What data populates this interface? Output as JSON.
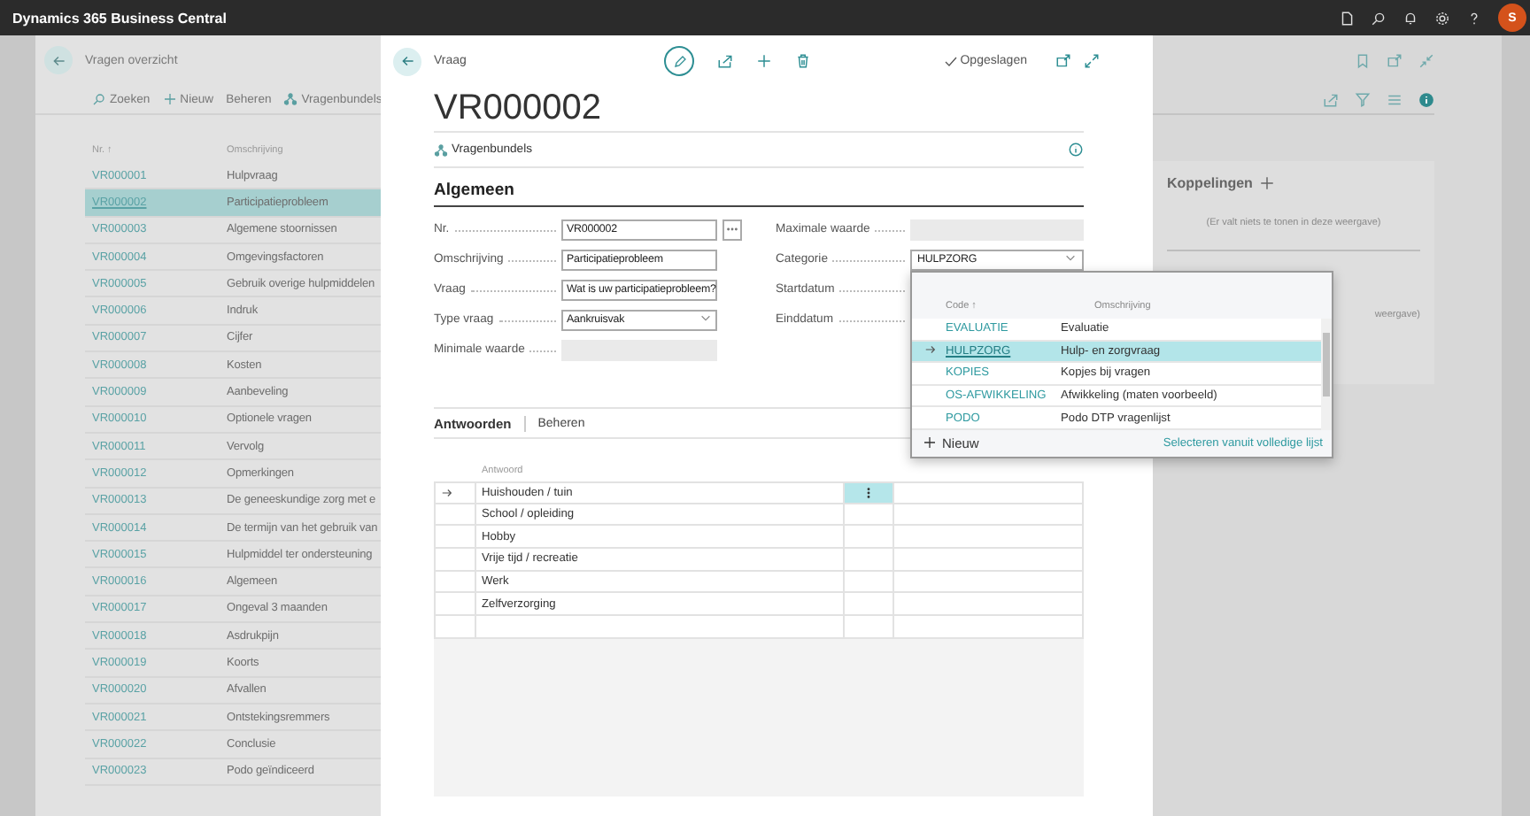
{
  "app_bar": {
    "title": "Dynamics 365 Business Central",
    "avatar": "S"
  },
  "background_page": {
    "title": "Vragen overzicht",
    "actions": [
      "Zoeken",
      "Nieuw",
      "Beheren",
      "Vragenbundels"
    ],
    "columns": [
      "Nr. ↑",
      "Omschrijving"
    ],
    "rows": [
      {
        "nr": "VR000001",
        "description": "Hulpvraag",
        "selected": false
      },
      {
        "nr": "VR000002",
        "description": "Participatieprobleem",
        "selected": true
      },
      {
        "nr": "VR000003",
        "description": "Algemene stoornissen",
        "selected": false
      },
      {
        "nr": "VR000004",
        "description": "Omgevingsfactoren",
        "selected": false
      },
      {
        "nr": "VR000005",
        "description": "Gebruik overige hulpmiddelen",
        "selected": false
      },
      {
        "nr": "VR000006",
        "description": "Indruk",
        "selected": false
      },
      {
        "nr": "VR000007",
        "description": "Cijfer",
        "selected": false
      },
      {
        "nr": "VR000008",
        "description": "Kosten",
        "selected": false
      },
      {
        "nr": "VR000009",
        "description": "Aanbeveling",
        "selected": false
      },
      {
        "nr": "VR000010",
        "description": "Optionele vragen",
        "selected": false
      },
      {
        "nr": "VR000011",
        "description": "Vervolg",
        "selected": false
      },
      {
        "nr": "VR000012",
        "description": "Opmerkingen",
        "selected": false
      },
      {
        "nr": "VR000013",
        "description": "De geneeskundige zorg met e",
        "selected": false
      },
      {
        "nr": "VR000014",
        "description": "De termijn van het gebruik van",
        "selected": false
      },
      {
        "nr": "VR000015",
        "description": "Hulpmiddel ter ondersteuning",
        "selected": false
      },
      {
        "nr": "VR000016",
        "description": "Algemeen",
        "selected": false
      },
      {
        "nr": "VR000017",
        "description": "Ongeval 3 maanden",
        "selected": false
      },
      {
        "nr": "VR000018",
        "description": "Asdrukpijn",
        "selected": false
      },
      {
        "nr": "VR000019",
        "description": "Koorts",
        "selected": false
      },
      {
        "nr": "VR000020",
        "description": "Afvallen",
        "selected": false
      },
      {
        "nr": "VR000021",
        "description": "Ontstekingsremmers",
        "selected": false
      },
      {
        "nr": "VR000022",
        "description": "Conclusie",
        "selected": false
      },
      {
        "nr": "VR000023",
        "description": "Podo geïndiceerd",
        "selected": false
      }
    ],
    "side_panel": {
      "title": "Koppelingen",
      "empty_text": "(Er valt niets te tonen in deze weergave)",
      "second_empty_text": "weergave)"
    }
  },
  "dialog": {
    "breadcrumb": "Vraag",
    "status": "Opgeslagen",
    "title": "VR000002",
    "action": "Vragenbundels",
    "section": "Algemeen",
    "fields_left": [
      {
        "label": "Nr.",
        "value": "VR000002",
        "kind": "lookup"
      },
      {
        "label": "Omschrijving",
        "value": "Participatieprobleem",
        "kind": "text"
      },
      {
        "label": "Vraag",
        "value": "Wat is uw participatieprobleem?",
        "kind": "text"
      },
      {
        "label": "Type vraag",
        "value": "Aankruisvak",
        "kind": "select"
      },
      {
        "label": "Minimale waarde",
        "kind": "disabled"
      }
    ],
    "fields_right": [
      {
        "label": "Maximale waarde",
        "kind": "disabled"
      },
      {
        "label": "Categorie",
        "value": "HULPZORG",
        "kind": "select"
      },
      {
        "label": "Startdatum",
        "kind": "covered"
      },
      {
        "label": "Einddatum",
        "kind": "covered"
      }
    ],
    "answers": {
      "tabs": [
        "Antwoorden",
        "Beheren"
      ],
      "column": "Antwoord",
      "rows": [
        {
          "text": "Huishouden / tuin",
          "selected": true
        },
        {
          "text": "School / opleiding",
          "selected": false
        },
        {
          "text": "Hobby",
          "selected": false
        },
        {
          "text": "Vrije tijd / recreatie",
          "selected": false
        },
        {
          "text": "Werk",
          "selected": false
        },
        {
          "text": "Zelfverzorging",
          "selected": false
        }
      ]
    }
  },
  "dropdown": {
    "columns": [
      "Code ↑",
      "Omschrijving"
    ],
    "rows": [
      {
        "code": "EVALUATIE",
        "description": "Evaluatie",
        "selected": false
      },
      {
        "code": "HULPZORG",
        "description": "Hulp- en zorgvraag",
        "selected": true
      },
      {
        "code": "KOPIES",
        "description": "Kopjes bij vragen",
        "selected": false
      },
      {
        "code": "OS-AFWIKKELING",
        "description": "Afwikkeling (maten voorbeeld)",
        "selected": false
      },
      {
        "code": "PODO",
        "description": "Podo DTP vragenlijst",
        "selected": false
      }
    ],
    "new": "Nieuw",
    "select_full": "Selecteren vanuit volledige lijst"
  }
}
